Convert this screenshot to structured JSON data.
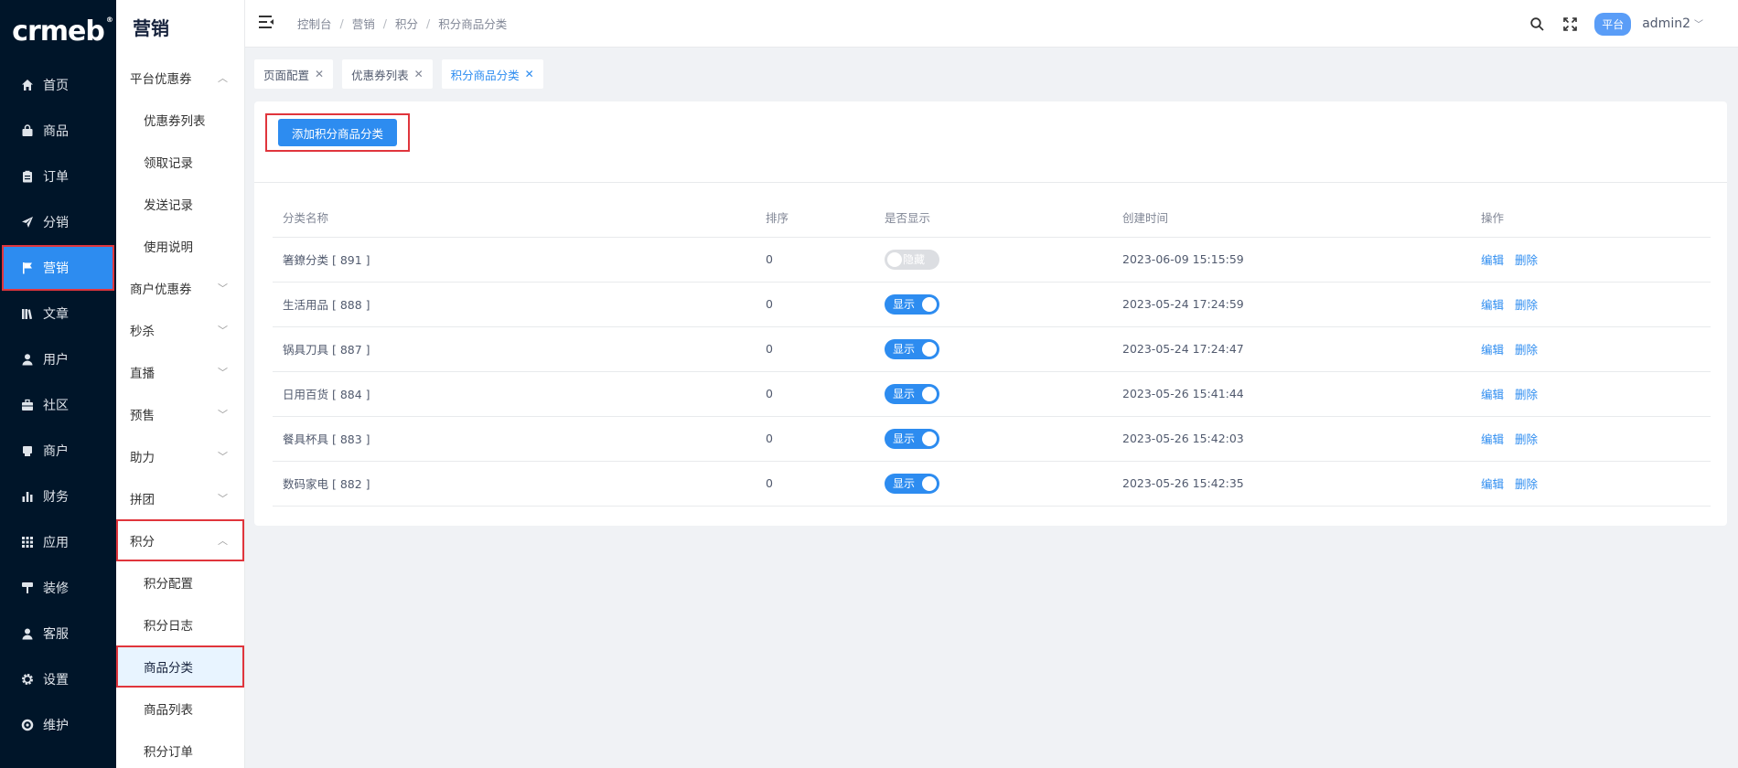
{
  "logo": {
    "text": "crmeb",
    "mark": "®"
  },
  "nav": [
    {
      "label": "首页",
      "icon": "home-icon"
    },
    {
      "label": "商品",
      "icon": "bag-icon"
    },
    {
      "label": "订单",
      "icon": "clipboard-icon"
    },
    {
      "label": "分销",
      "icon": "send-icon"
    },
    {
      "label": "营销",
      "icon": "flag-icon",
      "active": true
    },
    {
      "label": "文章",
      "icon": "book-icon"
    },
    {
      "label": "用户",
      "icon": "user-icon"
    },
    {
      "label": "社区",
      "icon": "briefcase-icon"
    },
    {
      "label": "商户",
      "icon": "store-icon"
    },
    {
      "label": "财务",
      "icon": "bar-chart-icon"
    },
    {
      "label": "应用",
      "icon": "grid-icon"
    },
    {
      "label": "装修",
      "icon": "paint-roller-icon"
    },
    {
      "label": "客服",
      "icon": "headset-icon"
    },
    {
      "label": "设置",
      "icon": "gear-icon"
    },
    {
      "label": "维护",
      "icon": "lifebuoy-icon"
    }
  ],
  "submenu": {
    "title": "营销",
    "groups": [
      {
        "label": "平台优惠券",
        "expanded": true,
        "items": [
          "优惠券列表",
          "领取记录",
          "发送记录",
          "使用说明"
        ]
      },
      {
        "label": "商户优惠券"
      },
      {
        "label": "秒杀"
      },
      {
        "label": "直播"
      },
      {
        "label": "预售"
      },
      {
        "label": "助力"
      },
      {
        "label": "拼团"
      },
      {
        "label": "积分",
        "expanded": true,
        "items": [
          "积分配置",
          "积分日志",
          "商品分类",
          "商品列表",
          "积分订单"
        ],
        "active_item": "商品分类"
      }
    ]
  },
  "header": {
    "breadcrumb": [
      "控制台",
      "营销",
      "积分",
      "积分商品分类"
    ],
    "role_badge": "平台",
    "username": "admin2"
  },
  "tabs": [
    {
      "label": "页面配置"
    },
    {
      "label": "优惠券列表"
    },
    {
      "label": "积分商品分类",
      "active": true
    }
  ],
  "content": {
    "add_button": "添加积分商品分类",
    "columns": [
      "分类名称",
      "排序",
      "是否显示",
      "创建时间",
      "操作"
    ],
    "rows": [
      {
        "name": "箸鐐分类 [ 891 ]",
        "sort": "0",
        "show": false,
        "switch_text": "隐藏",
        "created": "2023-06-09 15:15:59"
      },
      {
        "name": "生活用品 [ 888 ]",
        "sort": "0",
        "show": true,
        "switch_text": "显示",
        "created": "2023-05-24 17:24:59"
      },
      {
        "name": "锅具刀具 [ 887 ]",
        "sort": "0",
        "show": true,
        "switch_text": "显示",
        "created": "2023-05-24 17:24:47"
      },
      {
        "name": "日用百货 [ 884 ]",
        "sort": "0",
        "show": true,
        "switch_text": "显示",
        "created": "2023-05-26 15:41:44"
      },
      {
        "name": "餐具杯具 [ 883 ]",
        "sort": "0",
        "show": true,
        "switch_text": "显示",
        "created": "2023-05-26 15:42:03"
      },
      {
        "name": "数码家电 [ 882 ]",
        "sort": "0",
        "show": true,
        "switch_text": "显示",
        "created": "2023-05-26 15:42:35"
      }
    ],
    "actions": {
      "edit": "编辑",
      "delete": "删除"
    }
  },
  "colors": {
    "sidebar": "#001529",
    "primary": "#2d8cf0",
    "highlight_box": "#e0353c"
  }
}
